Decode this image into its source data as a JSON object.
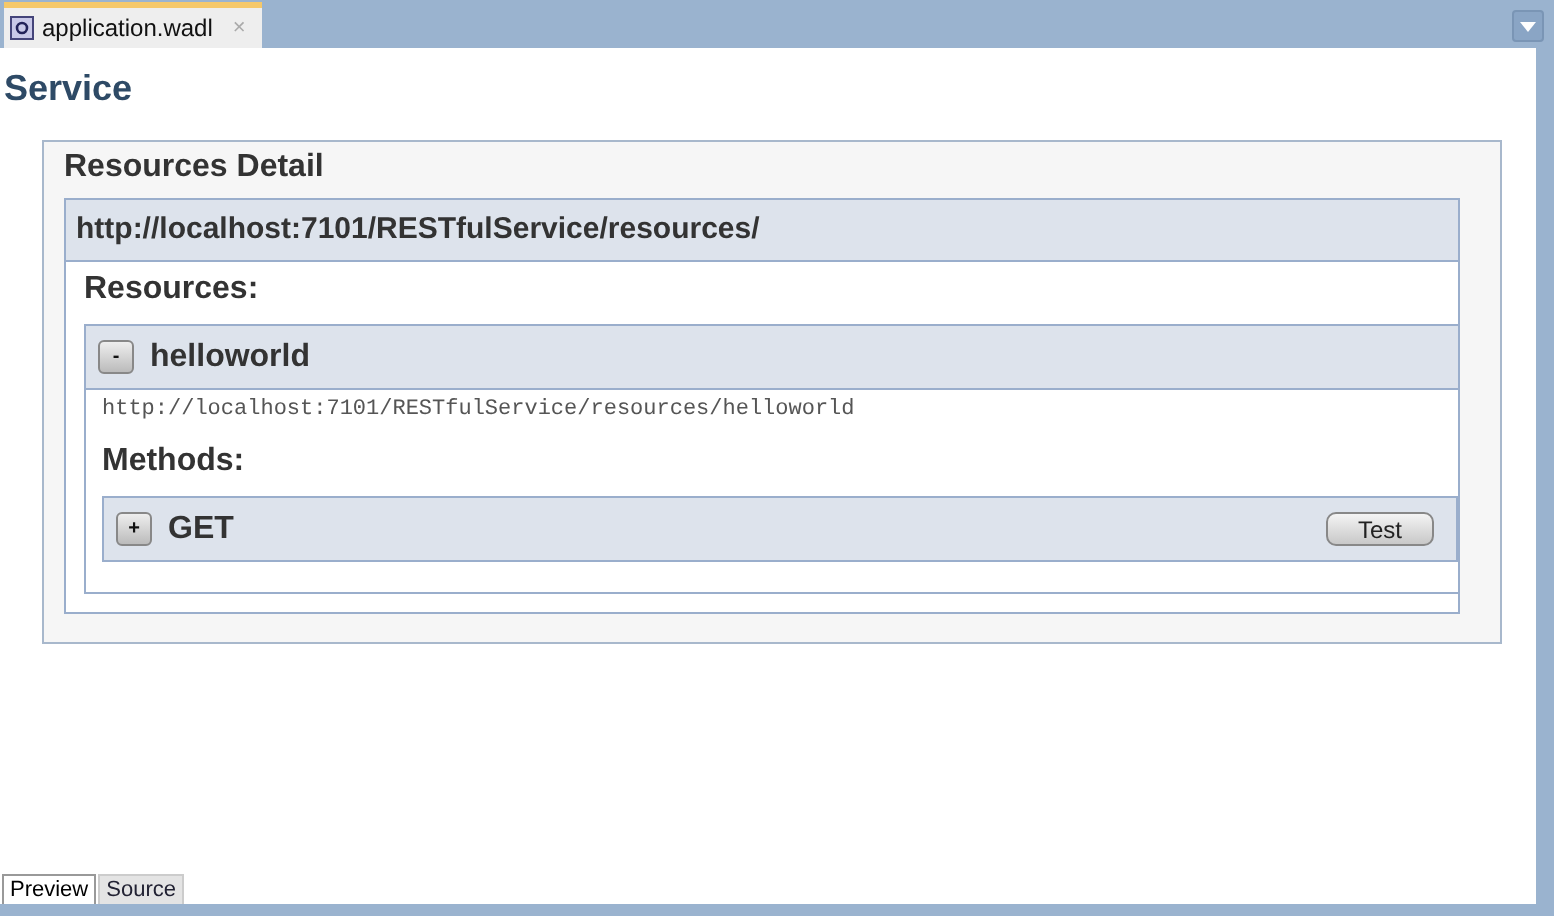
{
  "editor_tab": {
    "title": "application.wadl",
    "close": "×",
    "selected": true
  },
  "heading": "Service",
  "resources_detail": {
    "title": "Resources Detail",
    "base_url": "http://localhost:7101/RESTfulService/resources/",
    "resources_label": "Resources:",
    "resources": [
      {
        "toggle": "-",
        "name": "helloworld",
        "expanded": true,
        "url": "http://localhost:7101/RESTfulService/resources/helloworld",
        "methods_label": "Methods:",
        "methods": [
          {
            "toggle": "+",
            "name": "GET",
            "expanded": false,
            "test_button": "Test"
          }
        ]
      }
    ]
  },
  "bottom_tabs": [
    {
      "label": "Preview",
      "selected": true
    },
    {
      "label": "Source",
      "selected": false
    }
  ]
}
